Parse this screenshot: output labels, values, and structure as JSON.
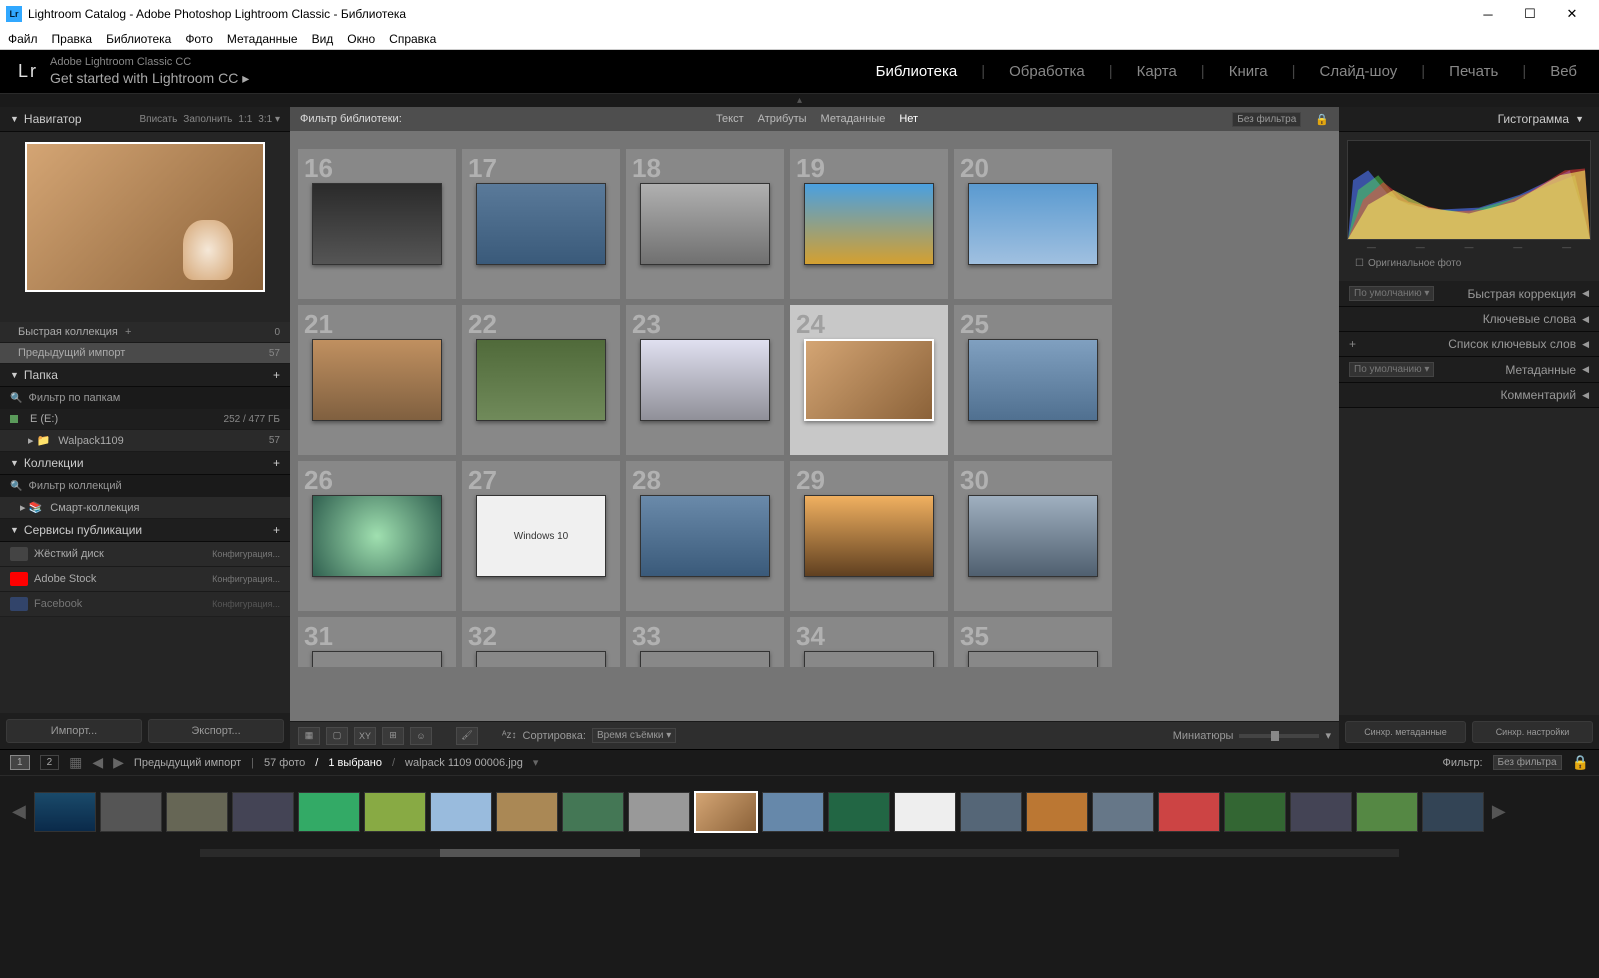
{
  "window": {
    "title": "Lightroom Catalog - Adobe Photoshop Lightroom Classic - Библиотека"
  },
  "menubar": [
    "Файл",
    "Правка",
    "Библиотека",
    "Фото",
    "Метаданные",
    "Вид",
    "Окно",
    "Справка"
  ],
  "header": {
    "logo": "Lr",
    "subtitle": "Adobe Lightroom Classic CC",
    "getstarted": "Get started with Lightroom CC  ▸",
    "modules": [
      "Библиотека",
      "Обработка",
      "Карта",
      "Книга",
      "Слайд-шоу",
      "Печать",
      "Веб"
    ],
    "active_module": 0
  },
  "navigator": {
    "title": "Навигатор",
    "fit": "Вписать",
    "fill": "Заполнить",
    "r11": "1:1",
    "r31": "3:1 ▾"
  },
  "catalog": {
    "quick": "Быстрая коллекция",
    "quick_count": "0",
    "prev_import": "Предыдущий импорт",
    "prev_count": "57"
  },
  "folders": {
    "title": "Папка",
    "filter": "Фильтр по папкам",
    "drive": "E (E:)",
    "drive_space": "252 / 477 ГБ",
    "folder": "Walpack1109",
    "folder_count": "57"
  },
  "collections": {
    "title": "Коллекции",
    "filter": "Фильтр коллекций",
    "smart": "Смарт-коллекция"
  },
  "publish": {
    "title": "Сервисы публикации",
    "hdd": "Жёсткий диск",
    "adobe": "Adobe Stock",
    "fb": "Facebook",
    "config": "Конфигурация..."
  },
  "left_buttons": {
    "import": "Импорт...",
    "export": "Экспорт..."
  },
  "filter_bar": {
    "label": "Фильтр библиотеки:",
    "text": "Текст",
    "attrs": "Атрибуты",
    "meta": "Метаданные",
    "none": "Нет",
    "nofilter": "Без фильтра"
  },
  "grid_numbers": [
    "16",
    "17",
    "18",
    "19",
    "20",
    "21",
    "22",
    "23",
    "24",
    "25",
    "26",
    "27",
    "28",
    "29",
    "30",
    "31",
    "32",
    "33",
    "34",
    "35"
  ],
  "windows10_label": "Windows 10",
  "toolbar": {
    "sort_label": "Сортировка:",
    "sort_value": "Время съёмки",
    "minis": "Миниатюры"
  },
  "right": {
    "histogram": "Гистограмма",
    "original": "Оригинальное фото",
    "default_dd": "По умолчанию",
    "quick": "Быстрая коррекция",
    "keywords": "Ключевые слова",
    "keywordlist": "Список ключевых слов",
    "metadata": "Метаданные",
    "comment": "Комментарий",
    "sync_meta": "Синхр. метаданные",
    "sync_settings": "Синхр. настройки"
  },
  "status": {
    "pg1": "1",
    "pg2": "2",
    "prev": "Предыдущий импорт",
    "count": "57 фото",
    "selected": "1 выбрано",
    "filename": "walpack 1109 00006.jpg",
    "filter_label": "Фильтр:",
    "filter_value": "Без фильтра"
  }
}
